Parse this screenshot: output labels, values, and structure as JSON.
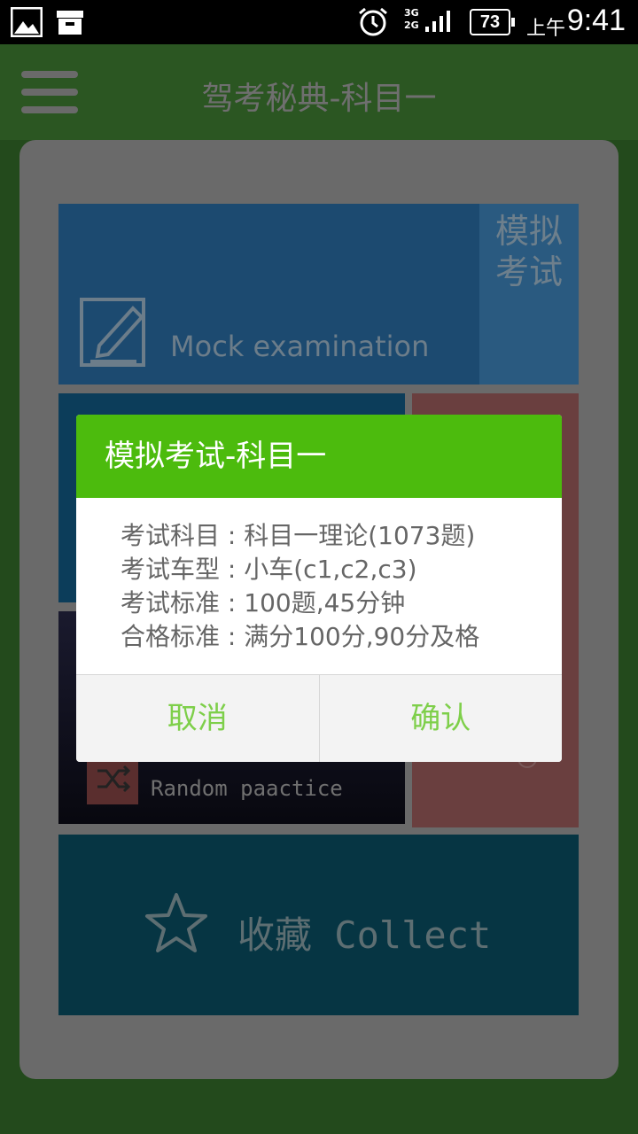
{
  "status_bar": {
    "network": "3G\n2G",
    "battery": "73",
    "ampm": "上午",
    "time": "9:41"
  },
  "app": {
    "title": "驾考秘典-科目一"
  },
  "tiles": {
    "mock": {
      "cn": "模拟\n考试",
      "en": "Mock examination"
    },
    "random": {
      "en": "Random paactice"
    },
    "collect": {
      "label": "收藏 Collect"
    }
  },
  "dialog": {
    "title": "模拟考试-科目一",
    "lines": [
      {
        "label": "考试科目",
        "value": "科目一理论(1073题)"
      },
      {
        "label": "考试车型",
        "value": "小车(c1,c2,c3)"
      },
      {
        "label": "考试标准",
        "value": "100题,45分钟"
      },
      {
        "label": "合格标准",
        "value": "满分100分,90分及格"
      }
    ],
    "cancel": "取消",
    "confirm": "确认"
  }
}
